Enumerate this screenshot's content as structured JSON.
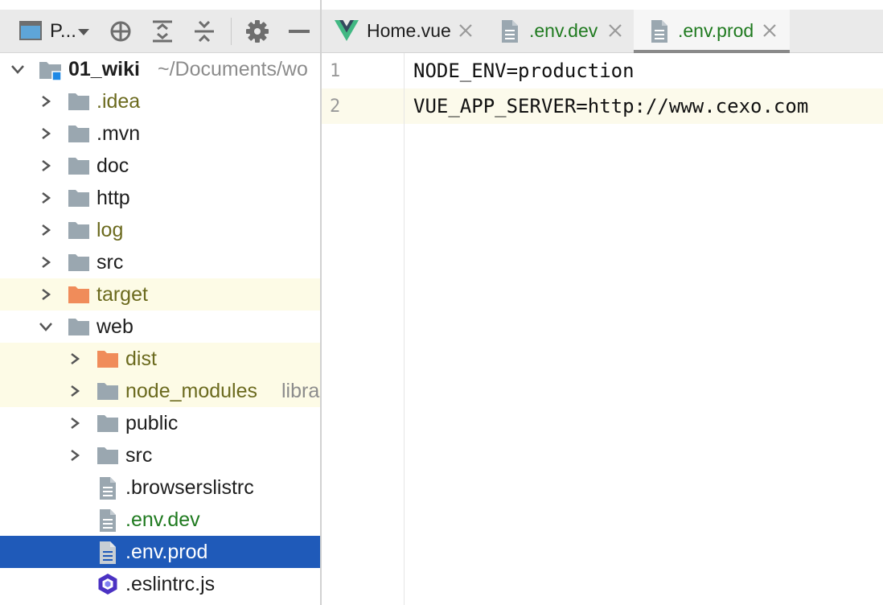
{
  "project_panel": {
    "view_label": "P...",
    "toolbar_icons": [
      "project-view-icon",
      "chevron-down-icon",
      "locate-icon",
      "expand-all-icon",
      "collapse-all-icon",
      "gear-icon",
      "minimize-icon"
    ],
    "tree": [
      {
        "label": "01_wiki",
        "path": "~/Documents/wo",
        "icon": "module-folder-icon",
        "expanded": true
      },
      {
        "label": ".idea",
        "icon": "folder-icon"
      },
      {
        "label": ".mvn",
        "icon": "folder-icon"
      },
      {
        "label": "doc",
        "icon": "folder-icon"
      },
      {
        "label": "http",
        "icon": "folder-icon"
      },
      {
        "label": "log",
        "icon": "folder-icon"
      },
      {
        "label": "src",
        "icon": "folder-icon"
      },
      {
        "label": "target",
        "icon": "excluded-folder-icon"
      },
      {
        "label": "web",
        "icon": "folder-icon",
        "expanded": true
      },
      {
        "label": "dist",
        "icon": "excluded-folder-icon"
      },
      {
        "label": "node_modules",
        "suffix": "libra",
        "icon": "library-folder-icon"
      },
      {
        "label": "public",
        "icon": "folder-icon"
      },
      {
        "label": "src",
        "icon": "folder-icon"
      },
      {
        "label": ".browserslistrc",
        "icon": "text-file-icon"
      },
      {
        "label": ".env.dev",
        "icon": "text-file-icon"
      },
      {
        "label": ".env.prod",
        "icon": "text-file-icon",
        "selected": true
      },
      {
        "label": ".eslintrc.js",
        "icon": "eslint-icon"
      }
    ]
  },
  "editor": {
    "tabs": [
      {
        "label": "Home.vue",
        "icon": "vue-icon"
      },
      {
        "label": ".env.dev",
        "icon": "text-file-icon"
      },
      {
        "label": ".env.prod",
        "icon": "text-file-icon",
        "active": true
      }
    ],
    "lines": [
      {
        "number": "1",
        "text": "NODE_ENV=production"
      },
      {
        "number": "2",
        "text": "VUE_APP_SERVER=http://www.cexo.com"
      }
    ]
  },
  "colors": {
    "selection": "#1f5ab9",
    "excluded_folder": "#f08c5a",
    "folder": "#9aa7b0",
    "modified_text": "#1f7a1f",
    "ignored_text": "#6b6a1e",
    "vue_green": "#41b883",
    "vue_dark": "#35495e"
  }
}
